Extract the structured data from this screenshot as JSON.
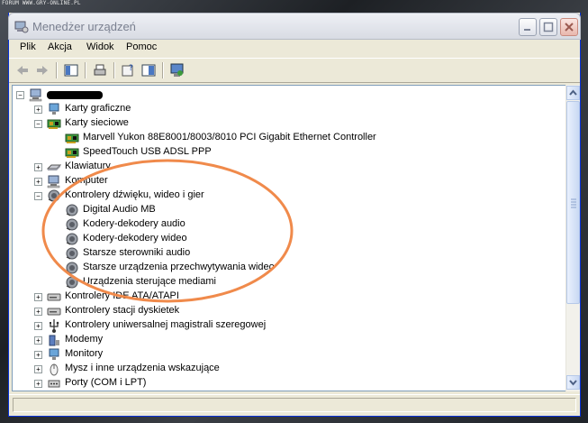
{
  "watermark": "FORUM WWW.GRY-ONLINE.PL",
  "window": {
    "title": "Menedżer urządzeń"
  },
  "menu": [
    "Plik",
    "Akcja",
    "Widok",
    "Pomoc"
  ],
  "tree": [
    {
      "level": 0,
      "label": "",
      "expanded": true,
      "icon": "computer-icon",
      "redacted": true
    },
    {
      "level": 1,
      "label": "Karty graficzne",
      "expanded": false,
      "icon": "monitor-icon"
    },
    {
      "level": 1,
      "label": "Karty sieciowe",
      "expanded": true,
      "icon": "network-card-icon"
    },
    {
      "level": 2,
      "label": "Marvell Yukon 88E8001/8003/8010 PCI Gigabit Ethernet Controller",
      "icon": "network-card-icon"
    },
    {
      "level": 2,
      "label": "SpeedTouch USB ADSL PPP",
      "icon": "network-card-icon"
    },
    {
      "level": 1,
      "label": "Klawiatury",
      "expanded": false,
      "icon": "keyboard-icon"
    },
    {
      "level": 1,
      "label": "Komputer",
      "expanded": false,
      "icon": "computer-icon"
    },
    {
      "level": 1,
      "label": "Kontrolery dźwięku, wideo i gier",
      "expanded": true,
      "icon": "speaker-icon"
    },
    {
      "level": 2,
      "label": "Digital Audio MB",
      "icon": "speaker-icon"
    },
    {
      "level": 2,
      "label": "Kodery-dekodery audio",
      "icon": "speaker-icon"
    },
    {
      "level": 2,
      "label": "Kodery-dekodery wideo",
      "icon": "speaker-icon"
    },
    {
      "level": 2,
      "label": "Starsze sterowniki audio",
      "icon": "speaker-icon"
    },
    {
      "level": 2,
      "label": "Starsze urządzenia przechwytywania wideo",
      "icon": "speaker-icon"
    },
    {
      "level": 2,
      "label": "Urządzenia sterujące mediami",
      "icon": "speaker-icon"
    },
    {
      "level": 1,
      "label": "Kontrolery IDE ATA/ATAPI",
      "expanded": false,
      "icon": "drive-icon"
    },
    {
      "level": 1,
      "label": "Kontrolery stacji dyskietek",
      "expanded": false,
      "icon": "drive-icon"
    },
    {
      "level": 1,
      "label": "Kontrolery uniwersalnej magistrali szeregowej",
      "expanded": false,
      "icon": "usb-icon"
    },
    {
      "level": 1,
      "label": "Modemy",
      "expanded": false,
      "icon": "modem-icon"
    },
    {
      "level": 1,
      "label": "Monitory",
      "expanded": false,
      "icon": "monitor-icon"
    },
    {
      "level": 1,
      "label": "Mysz i inne urządzenia wskazujące",
      "expanded": false,
      "icon": "mouse-icon"
    },
    {
      "level": 1,
      "label": "Porty (COM i LPT)",
      "expanded": false,
      "icon": "port-icon"
    }
  ],
  "colors": {
    "annotation": "#f08a4b",
    "titlebar_text": "#7a8090",
    "selection": "#316ac5"
  }
}
